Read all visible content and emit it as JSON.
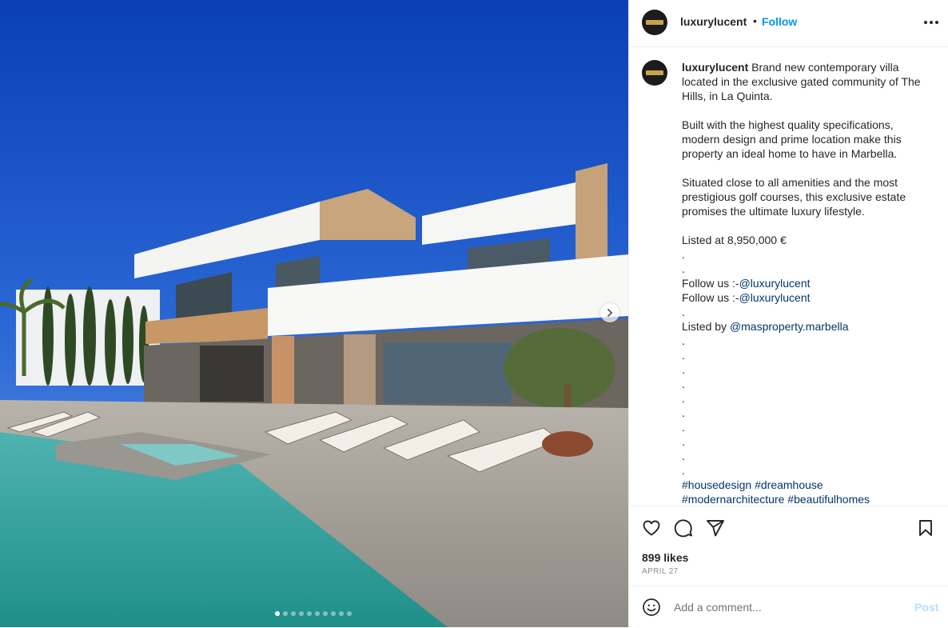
{
  "media": {
    "dots_total": 10,
    "active_dot": 0
  },
  "header": {
    "username": "luxurylucent",
    "separator": "•",
    "follow_label": "Follow"
  },
  "caption": {
    "username": "luxurylucent",
    "p1": "Brand new contemporary villa located in the exclusive gated community of The Hills, in La Quinta.",
    "p2": "Built with the highest quality specifications, modern design and prime location make this property an ideal home to have in Marbella.",
    "p3": "Situated close to all amenities and the most prestigious golf courses, this exclusive estate promises the ultimate luxury lifestyle.",
    "price": "Listed at 8,950,000 €",
    "dot": ".",
    "follow_prefix": "Follow us :-",
    "follow_mention": "@luxurylucent",
    "listed_prefix": "Listed by ",
    "listed_mention": "@masproperty.marbella",
    "tag_housedesign": "#housedesign",
    "tag_dreamhouse": "#dreamhouse",
    "tag_modernarchitecture": "#modernarchitecture",
    "tag_beautifulhomes": "#beautifulhomes"
  },
  "actions": {
    "likes": "899 likes",
    "date": "APRIL 27"
  },
  "comment": {
    "placeholder": "Add a comment...",
    "post_label": "Post"
  },
  "icons": [
    "heart-icon",
    "comment-icon",
    "share-icon",
    "bookmark-icon",
    "more-icon",
    "emoji-icon",
    "chevron-right-icon"
  ],
  "colors": {
    "follow": "#0095f6",
    "link": "#00376b",
    "post_disabled": "#b2dffc"
  }
}
